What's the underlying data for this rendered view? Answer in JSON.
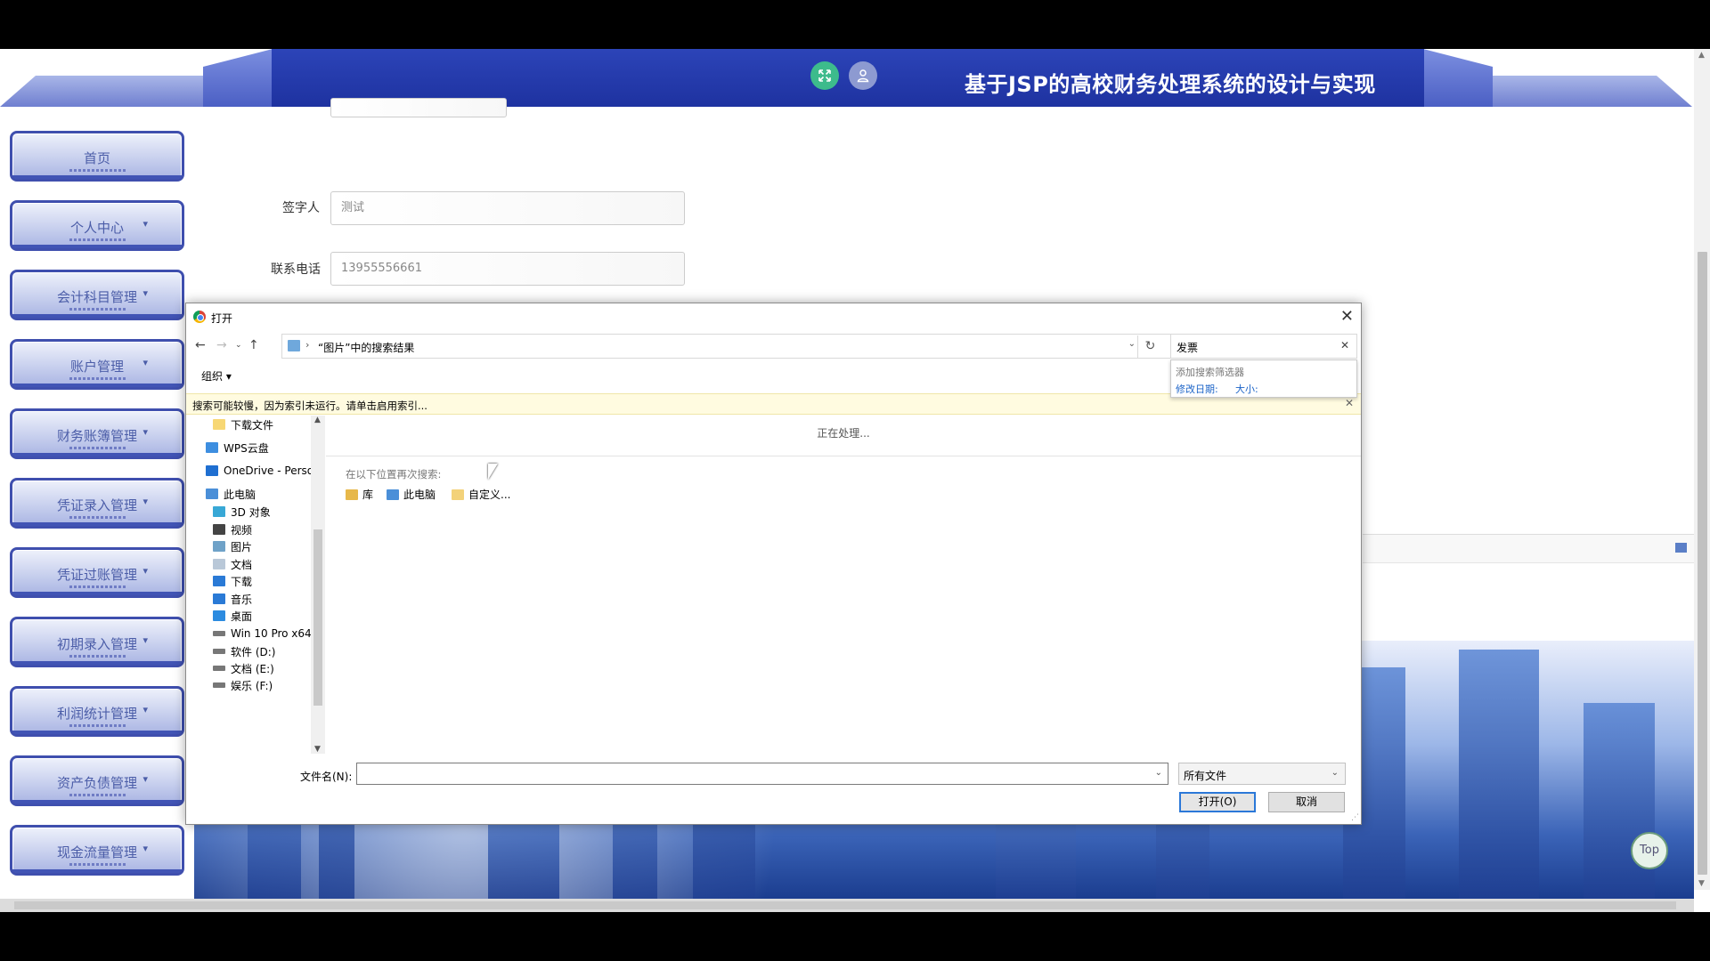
{
  "app": {
    "title": "基于JSP的高校财务处理系统的设计与实现",
    "colors": {
      "header": "#1e32a0",
      "nav_border": "#3f4fae",
      "accent_green": "#3dbb8c"
    }
  },
  "sidebar": {
    "items": [
      {
        "label": "首页"
      },
      {
        "label": "个人中心"
      },
      {
        "label": "会计科目管理"
      },
      {
        "label": "账户管理"
      },
      {
        "label": "财务账簿管理"
      },
      {
        "label": "凭证录入管理"
      },
      {
        "label": "凭证过账管理"
      },
      {
        "label": "初期录入管理"
      },
      {
        "label": "利润统计管理"
      },
      {
        "label": "资产负债管理"
      },
      {
        "label": "现金流量管理"
      }
    ],
    "dropdown_glyph": "▾"
  },
  "form": {
    "signer_label": "签字人",
    "signer_value": "测试",
    "phone_label": "联系电话",
    "phone_value": "13955556661"
  },
  "top_button": "Top",
  "dialog": {
    "title": "打开",
    "address": "“图片”中的搜索结果",
    "search_value": "发票",
    "search_popup": {
      "heading": "添加搜索筛选器",
      "filter_date": "修改日期:",
      "filter_size": "大小:"
    },
    "organize": "组织 ▾",
    "info_bar": "搜索可能较慢，因为索引未运行。请单击启用索引...",
    "tree": [
      {
        "label": "下载文件",
        "icon": "folder-icon"
      },
      {
        "label": "WPS云盘",
        "icon": "cloud-icon"
      },
      {
        "label": "OneDrive - Perso",
        "icon": "onedrive-icon"
      },
      {
        "label": "此电脑",
        "icon": "computer-icon"
      },
      {
        "label": "3D 对象",
        "icon": "cube-icon"
      },
      {
        "label": "视频",
        "icon": "video-icon"
      },
      {
        "label": "图片",
        "icon": "picture-icon"
      },
      {
        "label": "文档",
        "icon": "document-icon"
      },
      {
        "label": "下载",
        "icon": "download-icon"
      },
      {
        "label": "音乐",
        "icon": "music-icon"
      },
      {
        "label": "桌面",
        "icon": "desktop-icon"
      },
      {
        "label": "Win 10 Pro x64",
        "icon": "drive-icon"
      },
      {
        "label": "软件 (D:)",
        "icon": "drive-icon"
      },
      {
        "label": "文档 (E:)",
        "icon": "drive-icon"
      },
      {
        "label": "娱乐 (F:)",
        "icon": "drive-icon"
      }
    ],
    "processing": "正在处理...",
    "search_again": "在以下位置再次搜索:",
    "locations": [
      {
        "label": "库",
        "icon": "library-icon"
      },
      {
        "label": "此电脑",
        "icon": "computer-icon"
      },
      {
        "label": "自定义...",
        "icon": "custom-folder-icon"
      }
    ],
    "filename_label": "文件名(N):",
    "filename_value": "",
    "file_type": "所有文件",
    "open_button": "打开(O)",
    "cancel_button": "取消"
  }
}
